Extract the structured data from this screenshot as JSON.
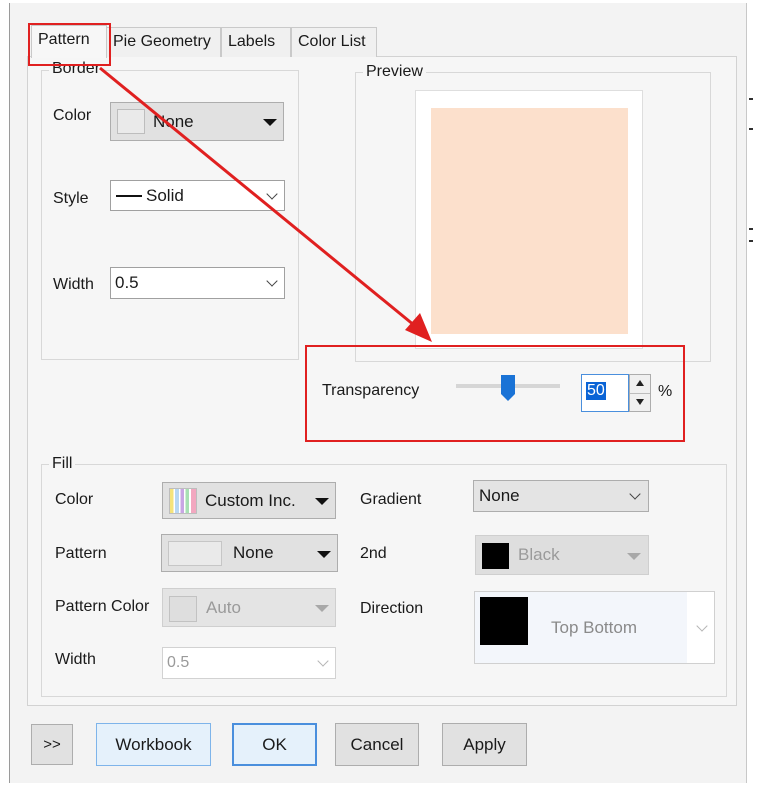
{
  "tabs": [
    "Pattern",
    "Pie Geometry",
    "Labels",
    "Color List"
  ],
  "border": {
    "legend": "Border",
    "color_label": "Color",
    "color_value": "None",
    "style_label": "Style",
    "style_value": "Solid",
    "width_label": "Width",
    "width_value": "0.5"
  },
  "preview": {
    "legend": "Preview",
    "fill_color": "#fce0cc"
  },
  "transparency": {
    "label": "Transparency",
    "value": "50",
    "unit": "%",
    "level_percent": 50
  },
  "fill": {
    "legend": "Fill",
    "color_label": "Color",
    "color_value": "Custom Inc.",
    "pattern_label": "Pattern",
    "pattern_value": "None",
    "pattern_color_label": "Pattern Color",
    "pattern_color_value": "Auto",
    "width_label": "Width",
    "width_value": "0.5",
    "gradient_label": "Gradient",
    "gradient_value": "None",
    "second_label": "2nd",
    "second_value": "Black",
    "direction_label": "Direction",
    "direction_value": "Top Bottom"
  },
  "buttons": {
    "expand": ">>",
    "workbook": "Workbook",
    "ok": "OK",
    "cancel": "Cancel",
    "apply": "Apply"
  },
  "colors": {
    "highlight_red": "#e02020",
    "focus_blue": "#4a8fdd",
    "slider_thumb": "#1a73d6"
  }
}
